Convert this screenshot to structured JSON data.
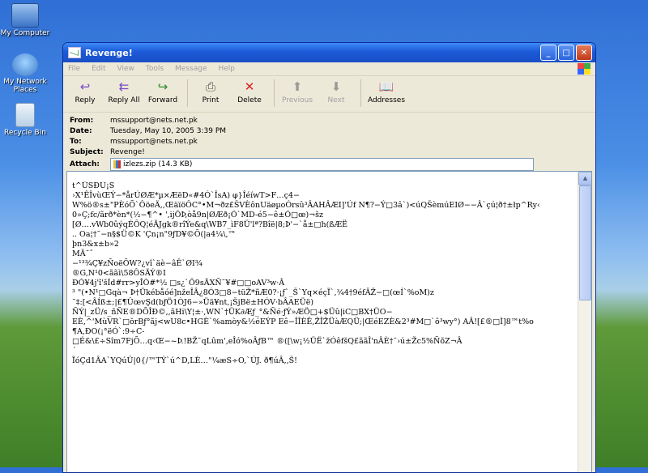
{
  "desktop": {
    "icons": [
      {
        "label": "My Computer",
        "color": "#5a8fd8"
      },
      {
        "label": "My Network Places",
        "color": "#3b78c9"
      },
      {
        "label": "Recycle Bin",
        "color": "#d8e7f3"
      }
    ]
  },
  "window": {
    "title": "Revenge!",
    "menu": [
      "File",
      "Edit",
      "View",
      "Tools",
      "Message",
      "Help"
    ],
    "toolbar": {
      "reply": "Reply",
      "reply_all": "Reply All",
      "forward": "Forward",
      "print": "Print",
      "delete": "Delete",
      "previous": "Previous",
      "next": "Next",
      "addresses": "Addresses"
    },
    "headers": {
      "from_label": "From:",
      "from": "mssupport@nets.net.pk",
      "date_label": "Date:",
      "date": "Tuesday, May 10, 2005 3:39 PM",
      "to_label": "To:",
      "to": "mssupport@nets.net.pk",
      "subject_label": "Subject:",
      "subject": "Revenge!",
      "attach_label": "Attach:",
      "attachment": "izlezs.zip (14.3 KB)"
    },
    "body_lines": [
      "t^ÜSĐÙ¡Š",
      "›X¹ÊÎvùŒÝ−*årÚØÆ*µ×ÆëD«#4Ó`ÎsA) φ}ÎéíwT>F…ç4−",
      "W%ö®s±\"PÈóÕ`ÔöeÄ,,ŒäïöÔC°•M¬ðz£ŠVÈônUäøµoÓrsû³ÂAHÂÆI]'Úf N¶?−Ý□3â`)<úQŠèmúEIØ−−Â`çú¦ð†±łp^Ry‹",
      "0»Ç;fc/ãrð*èn*(½−¶^• ',ijÔÞ,òå9n|ØÆð¡Ó`MD-é5−ê±Ó□œ)¬šz",
      "[Ø….vWb0ûýqÉÔQ¦éÃJgk®rîÝe&q\\WB7_ìF8Ü'lª?Bîë|8;Þ'−`å±□h(ßÆË",
      ".. Oa¦†˜−n§$Ü©K 'Çn¡n\"9ƒD¥©Õ(|a4¼\\,™",
      "þn3&x±b»2",
      "MÄ¯ˆ",
      "−¹³³⁄₄Ç¥zÑoëÕW?¿vî`äè−âÊ`ØI³⁄₄",
      "®G,N¹0<ããì\\58ÔSÃÝ®I",
      "ĐÓ¥4j'î'šÍd#rr>yÎÒ#*½ □s¿`Ô9sÃXÑ¯¥#□□oAV³w·Â",
      "³ \"(•N¹□Gqà¬ Þ†Ükébåóé]nžeÎÂ¿8Ó3□8−tüŽ*ñÆ0?·¡ƒ`_Š`Yq×éçÏ`,¾4†9éfÂŽ−□(œÍ`%oM)z",
      "˜‡:[<ÂÍß±;|£¶ÛœvŞd(bƒÖ1ÒJ6−»Üä¥nt,¡ŠjBë±HÓV·bÂAEÜë)",
      "ÑÝ|_zÜ/s_ñÑE®DÕÎÐ©,,ãHi\\Y¦±·,WN`†ÜK∂Æƒ_°&Ñé·ƒÝ»ÆÖ□+$Üû|iC□BX†ÜO−",
      "EÈ,^'MùVR`□ŏrBƒ°ãj<wU8c•HGÈ`%amòy&½éEÝP Eê−ÎÎÈÊ,ŽÎŽÜàÆQÜ;|ŒéEZÈ&2³#M□`ô³wy°) AÂ![£®□Ì]8™t%o",
      "¶A,ĐO(¡°ëÓ`:9÷C-",
      "□É&\\£÷Sîm7FjÕ…q‹Œ−~Þ.!BŽ¯qLûm',eÎó%oÂƒB™ ®([\\w¡½ÜË`žÓêfšQ£ããÎ'nÂÈ†¯›ú±Žc5%ÑõZ¬Â",
      "´",
      "ÏóÇd1ÂA`YQúÛ|0{/™TÝ`ú^D,LÈ…\"¼æS÷O,`ÚJ. ð¶úÂ,,Š!"
    ]
  }
}
